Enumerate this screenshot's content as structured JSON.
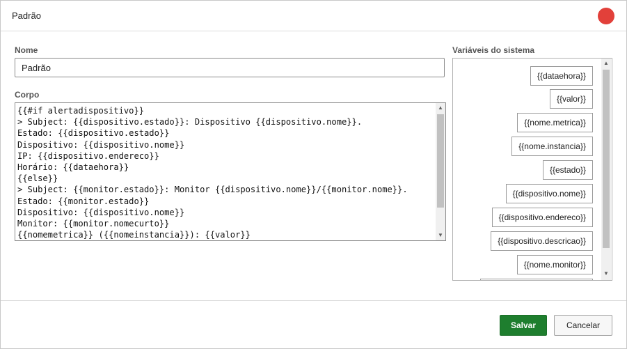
{
  "dialog": {
    "title": "Padrão"
  },
  "colors": {
    "close": "#e2403a",
    "save": "#1e7e2e"
  },
  "form": {
    "name_label": "Nome",
    "name_value": "Padrão",
    "body_label": "Corpo",
    "body_lines": [
      "{{#if alertadispositivo}}",
      "> Subject: {{dispositivo.estado}}: Dispositivo {{dispositivo.nome}}.",
      "Estado: {{dispositivo.estado}}",
      "Dispositivo: {{dispositivo.nome}}",
      "IP: {{dispositivo.endereco}}",
      "Horário: {{dataehora}}",
      "{{else}}",
      "> Subject: {{monitor.estado}}: Monitor {{dispositivo.nome}}/{{monitor.nome}}.",
      "Estado: {{monitor.estado}}",
      "Dispositivo: {{dispositivo.nome}}",
      "Monitor: {{monitor.nomecurto}}",
      "{{nomemetrica}} ({{nomeinstancia}}): {{valor}}"
    ]
  },
  "variables": {
    "label": "Variáveis do sistema",
    "items": [
      "{{dataehora}}",
      "{{valor}}",
      "{{nome.metrica}}",
      "{{nome.instancia}}",
      "{{estado}}",
      "{{dispositivo.nome}}",
      "{{dispositivo.endereco}}",
      "{{dispositivo.descricao}}",
      "{{nome.monitor}}"
    ]
  },
  "footer": {
    "save_label": "Salvar",
    "cancel_label": "Cancelar"
  }
}
